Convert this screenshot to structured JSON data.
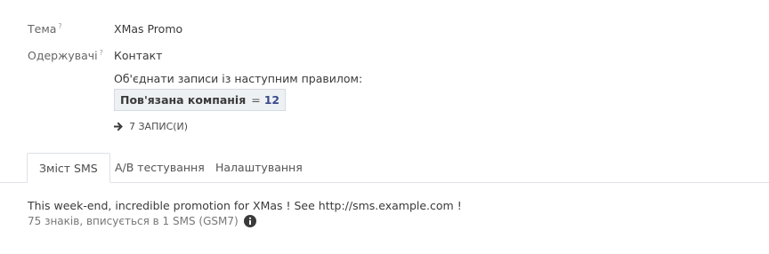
{
  "fields": {
    "subject_label": "Тема",
    "subject_help": "?",
    "subject_value": "XMas Promo",
    "recipients_label": "Одержувачі",
    "recipients_help": "?",
    "recipients_value": "Контакт"
  },
  "domain": {
    "intro": "Об'єднати записи із наступним правилом:",
    "field": "Пов'язана компанія",
    "operator": "=",
    "value": "12",
    "records_link": "7 ЗАПИС(И)"
  },
  "tabs": [
    {
      "label": "Зміст SMS",
      "active": true
    },
    {
      "label": "A/B тестування",
      "active": false
    },
    {
      "label": "Налаштування",
      "active": false
    }
  ],
  "sms": {
    "body": "This week-end, incredible promotion for XMas ! See http://sms.example.com !",
    "count": "75 знаків, вписується в 1 SMS (GSM7)"
  },
  "icons": {
    "records_link_icon": "arrow-right-icon",
    "info_icon": "info-circle-icon"
  }
}
